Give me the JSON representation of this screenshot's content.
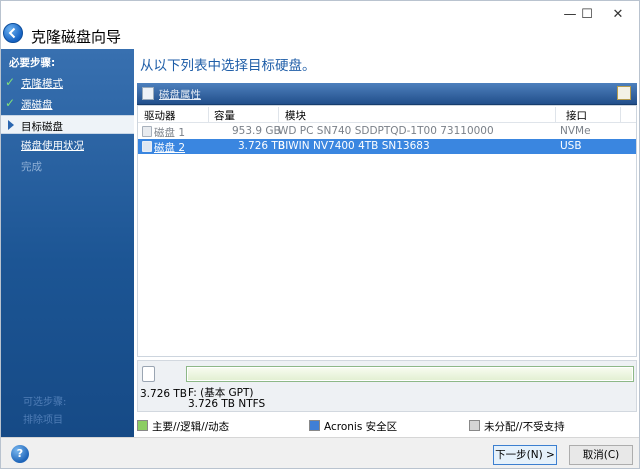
{
  "window": {
    "title": "克隆磁盘向导",
    "controls": {
      "minimize": "—",
      "maximize": "☐",
      "close": "✕"
    }
  },
  "sidebar": {
    "steps_label": "必要步骤:",
    "steps": [
      {
        "label": "克隆模式",
        "state": "done"
      },
      {
        "label": "源磁盘",
        "state": "done"
      },
      {
        "label": "目标磁盘",
        "state": "active"
      },
      {
        "label": "磁盘使用状况",
        "state": "link"
      },
      {
        "label": "完成",
        "state": "disabled"
      }
    ],
    "ghost": [
      "可选步骤:",
      "排除项目"
    ]
  },
  "main": {
    "heading": "从以下列表中选择目标硬盘。",
    "toolbar": {
      "disk_properties": "磁盘属性"
    },
    "table": {
      "columns": [
        "驱动器",
        "容量",
        "模块",
        "接口"
      ],
      "rows": [
        {
          "drive": "磁盘 1",
          "capacity": "953.9 GB",
          "model": "WD PC SN740 SDDPTQD-1T00 73110000",
          "interface": "NVMe",
          "selected": false
        },
        {
          "drive": "磁盘 2",
          "capacity": "3.726 TB",
          "model": "BIWIN NV7400 4TB SN13683",
          "interface": "USB",
          "selected": true
        }
      ]
    },
    "partition": {
      "disk_capacity": "3.726 TB",
      "name": "F: (基本 GPT)",
      "size": "3.726 TB   NTFS",
      "used_fraction": 0.006
    },
    "legend": [
      {
        "label": "主要//逻辑//动态",
        "color": "#8ccd63"
      },
      {
        "label": "Acronis 安全区",
        "color": "#3f7fd6"
      },
      {
        "label": "未分配//不受支持",
        "color": "#d5d5d5"
      }
    ]
  },
  "footer": {
    "help": "?",
    "next": "下一步(N) >",
    "cancel": "取消(C)"
  }
}
